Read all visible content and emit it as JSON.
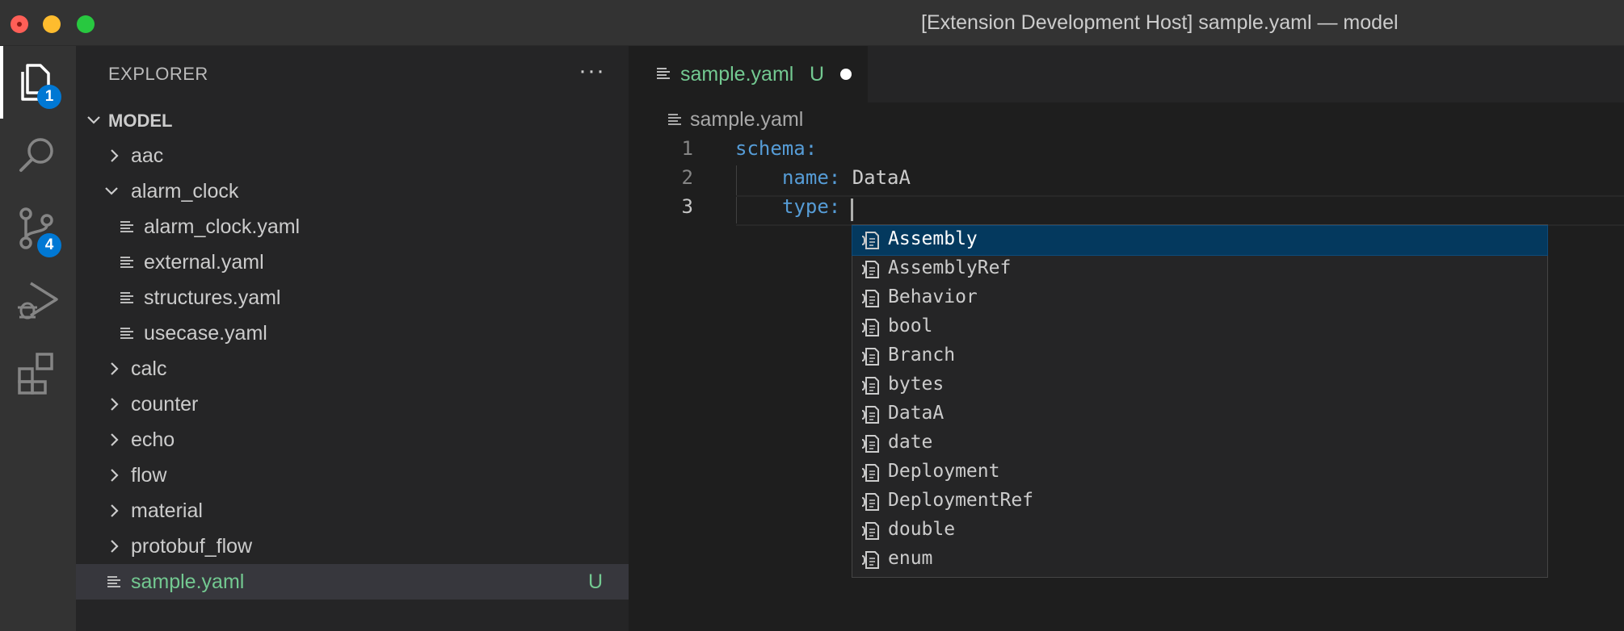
{
  "window": {
    "title": "[Extension Development Host] sample.yaml — model"
  },
  "activity_bar": {
    "explorer_badge": "1",
    "scm_badge": "4"
  },
  "sidebar": {
    "title": "EXPLORER",
    "more_actions": "···",
    "root_folder": "MODEL",
    "tree": [
      {
        "label": "aac",
        "kind": "folder",
        "expanded": false
      },
      {
        "label": "alarm_clock",
        "kind": "folder",
        "expanded": true
      },
      {
        "label": "alarm_clock.yaml",
        "kind": "file"
      },
      {
        "label": "external.yaml",
        "kind": "file"
      },
      {
        "label": "structures.yaml",
        "kind": "file"
      },
      {
        "label": "usecase.yaml",
        "kind": "file"
      },
      {
        "label": "calc",
        "kind": "folder",
        "expanded": false
      },
      {
        "label": "counter",
        "kind": "folder",
        "expanded": false
      },
      {
        "label": "echo",
        "kind": "folder",
        "expanded": false
      },
      {
        "label": "flow",
        "kind": "folder",
        "expanded": false
      },
      {
        "label": "material",
        "kind": "folder",
        "expanded": false
      },
      {
        "label": "protobuf_flow",
        "kind": "folder",
        "expanded": false
      },
      {
        "label": "sample.yaml",
        "kind": "file",
        "status": "U",
        "selected": true
      }
    ]
  },
  "editor": {
    "tab": {
      "label": "sample.yaml",
      "status": "U",
      "dirty": true
    },
    "breadcrumb": "sample.yaml",
    "lines": [
      {
        "number": "1",
        "key": "schema:",
        "value": ""
      },
      {
        "number": "2",
        "key": "name:",
        "value": "DataA"
      },
      {
        "number": "3",
        "key": "type:",
        "value": ""
      }
    ]
  },
  "suggestions": {
    "focused": "Assembly",
    "items": [
      "Assembly",
      "AssemblyRef",
      "Behavior",
      "bool",
      "Branch",
      "bytes",
      "DataA",
      "date",
      "Deployment",
      "DeploymentRef",
      "double",
      "enum"
    ]
  },
  "colors": {
    "untracked": "#73c991",
    "yaml_key": "#569cd6",
    "badge": "#0078d4",
    "suggest_focus": "#04395e"
  }
}
